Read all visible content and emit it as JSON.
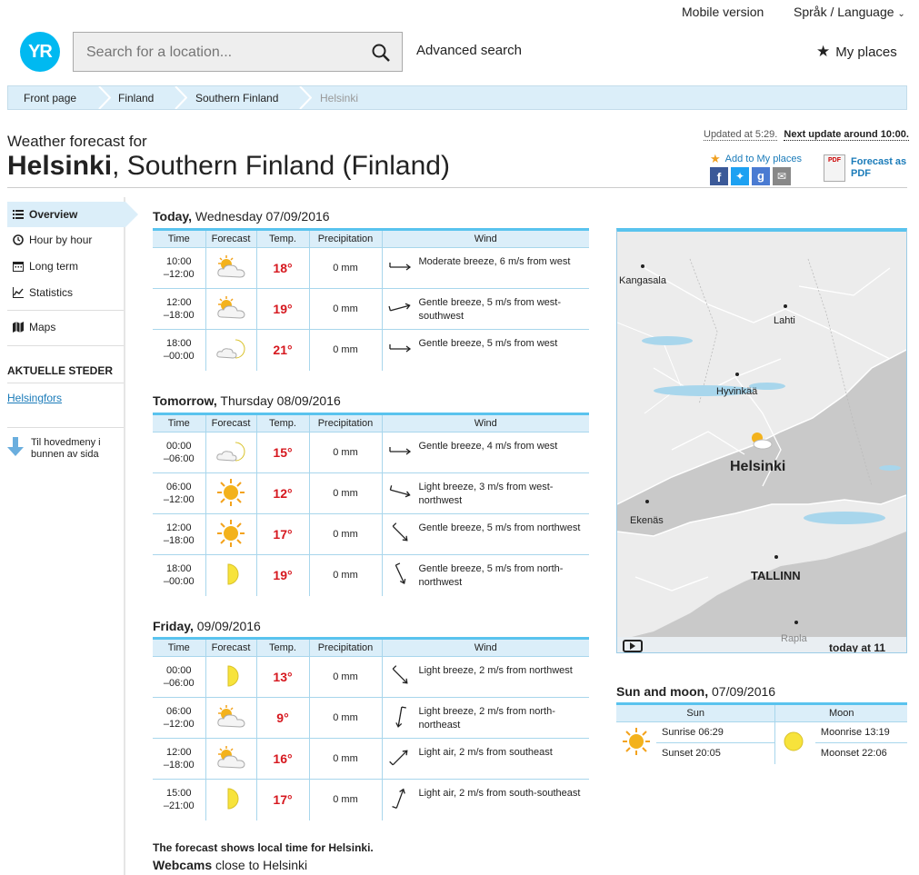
{
  "top_links": {
    "mobile": "Mobile version",
    "language": "Språk / Language"
  },
  "header": {
    "logo": "YR",
    "search_placeholder": "Search for a location...",
    "advanced": "Advanced search",
    "my_places": "My places"
  },
  "breadcrumb": [
    "Front page",
    "Finland",
    "Southern Finland",
    "Helsinki"
  ],
  "title": {
    "prefix": "Weather forecast for",
    "city": "Helsinki",
    "region": ", Southern Finland (Finland)"
  },
  "update": {
    "updated": "Updated at 5:29.",
    "next": "Next update around 10:00."
  },
  "actions": {
    "add_places": "Add to My places",
    "pdf": "Forecast as PDF",
    "pdf_line1": "Forecast as",
    "pdf_line2": "PDF"
  },
  "sidebar": {
    "items": [
      "Overview",
      "Hour by hour",
      "Long term",
      "Statistics",
      "Maps"
    ],
    "section": "AKTUELLE STEDER",
    "link": "Helsingfors",
    "bottom_line1": "Til hovedmeny i",
    "bottom_line2": "bunnen av sida"
  },
  "table_headers": [
    "Time",
    "Forecast",
    "Temp.",
    "Precipitation",
    "Wind"
  ],
  "days": [
    {
      "label": "Today,",
      "date": " Wednesday 07/09/2016",
      "rows": [
        {
          "t1": "10:00",
          "t2": "–12:00",
          "icon": "partly-cloudy-sun-icon",
          "temp": "18°",
          "precip": "0 mm",
          "wind": "Moderate breeze, 6 m/s from west",
          "dir": "west"
        },
        {
          "t1": "12:00",
          "t2": "–18:00",
          "icon": "partly-cloudy-sun-icon",
          "temp": "19°",
          "precip": "0 mm",
          "wind": "Gentle breeze, 5 m/s from west-southwest",
          "dir": "wsw"
        },
        {
          "t1": "18:00",
          "t2": "–00:00",
          "icon": "cloud-moon-icon",
          "temp": "21°",
          "precip": "0 mm",
          "wind": "Gentle breeze, 5 m/s from west",
          "dir": "west"
        }
      ]
    },
    {
      "label": "Tomorrow,",
      "date": " Thursday 08/09/2016",
      "rows": [
        {
          "t1": "00:00",
          "t2": "–06:00",
          "icon": "cloud-moon-icon",
          "temp": "15°",
          "precip": "0 mm",
          "wind": "Gentle breeze, 4 m/s from west",
          "dir": "west"
        },
        {
          "t1": "06:00",
          "t2": "–12:00",
          "icon": "sun-icon",
          "temp": "12°",
          "precip": "0 mm",
          "wind": "Light breeze, 3 m/s from west-northwest",
          "dir": "wnw"
        },
        {
          "t1": "12:00",
          "t2": "–18:00",
          "icon": "sun-icon",
          "temp": "17°",
          "precip": "0 mm",
          "wind": "Gentle breeze, 5 m/s from northwest",
          "dir": "nw"
        },
        {
          "t1": "18:00",
          "t2": "–00:00",
          "icon": "moon-icon",
          "temp": "19°",
          "precip": "0 mm",
          "wind": "Gentle breeze, 5 m/s from north-northwest",
          "dir": "nnw"
        }
      ]
    },
    {
      "label": "Friday,",
      "date": " 09/09/2016",
      "rows": [
        {
          "t1": "00:00",
          "t2": "–06:00",
          "icon": "moon-icon",
          "temp": "13°",
          "precip": "0 mm",
          "wind": "Light breeze, 2 m/s from northwest",
          "dir": "nw"
        },
        {
          "t1": "06:00",
          "t2": "–12:00",
          "icon": "partly-cloudy-sun-icon",
          "temp": "9°",
          "precip": "0 mm",
          "wind": "Light breeze, 2 m/s from north-northeast",
          "dir": "nne"
        },
        {
          "t1": "12:00",
          "t2": "–18:00",
          "icon": "partly-cloudy-sun-icon",
          "temp": "16°",
          "precip": "0 mm",
          "wind": "Light air, 2 m/s from southeast",
          "dir": "se"
        },
        {
          "t1": "15:00",
          "t2": "–21:00",
          "icon": "moon-icon",
          "temp": "17°",
          "precip": "0 mm",
          "wind": "Light air, 2 m/s from south-southeast",
          "dir": "sse"
        }
      ]
    }
  ],
  "map": {
    "cities": [
      "Kangasala",
      "Lahti",
      "Hyvinkää",
      "Helsinki",
      "Ekenäs",
      "TALLINN",
      "Rapla"
    ],
    "time": "today at 11"
  },
  "sunmoon": {
    "title": "Sun and moon,",
    "date": " 07/09/2016",
    "sun_head": "Sun",
    "moon_head": "Moon",
    "sunrise": "Sunrise 06:29",
    "sunset": "Sunset 20:05",
    "moonrise": "Moonrise 13:19",
    "moonset": "Moonset 22:06"
  },
  "footer": {
    "note": "The forecast shows local time for Helsinki.",
    "webcams_b": "Webcams",
    "webcams": " close to Helsinki"
  },
  "colors": {
    "accent": "#59c3ee",
    "light": "#dbeef9",
    "temp": "#d6181f",
    "logo": "#00b9f1"
  }
}
